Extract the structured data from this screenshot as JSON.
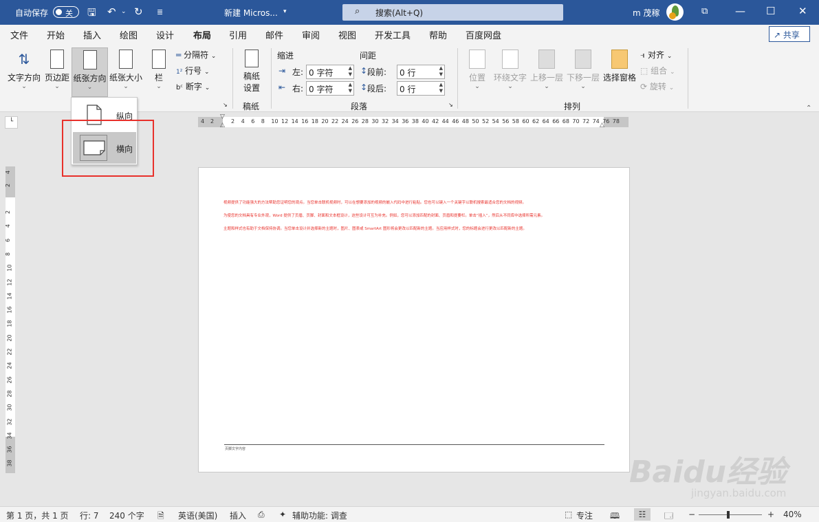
{
  "titlebar": {
    "autosave_label": "自动保存",
    "autosave_state": "关",
    "doc_title": "新建 Micros...",
    "search_placeholder": "搜索(Alt+Q)",
    "user_name": "m 茂稼"
  },
  "menu": {
    "tabs": [
      "文件",
      "开始",
      "插入",
      "绘图",
      "设计",
      "布局",
      "引用",
      "邮件",
      "审阅",
      "视图",
      "开发工具",
      "帮助",
      "百度网盘"
    ],
    "active": "布局",
    "share": "共享"
  },
  "ribbon": {
    "text_direction": "文字方向",
    "margins": "页边距",
    "orientation": "纸张方向",
    "size": "纸张大小",
    "columns": "栏",
    "breaks": "分隔符",
    "line_numbers": "行号",
    "hyphenation": "断字",
    "draft_settings_line1": "稿纸",
    "draft_settings_line2": "设置",
    "draft_group": "稿纸",
    "indent_label": "缩进",
    "spacing_label": "间距",
    "indent_left_label": "左:",
    "indent_left_value": "0 字符",
    "indent_right_label": "右:",
    "indent_right_value": "0 字符",
    "space_before_label": "段前:",
    "space_before_value": "0 行",
    "space_after_label": "段后:",
    "space_after_value": "0 行",
    "paragraph_group": "段落",
    "position": "位置",
    "wrap_text": "环绕文字",
    "bring_forward": "上移一层",
    "send_backward": "下移一层",
    "selection_pane": "选择窗格",
    "align": "对齐",
    "group": "组合",
    "rotate": "旋转",
    "arrange_group": "排列"
  },
  "orientation_menu": {
    "portrait": "纵向",
    "landscape": "横向",
    "selected": "横向"
  },
  "ruler": {
    "h_ticks": [
      "4",
      "2",
      "2",
      "4",
      "6",
      "8",
      "10",
      "12",
      "14",
      "16",
      "18",
      "20",
      "22",
      "24",
      "26",
      "28",
      "30",
      "32",
      "34",
      "36",
      "38",
      "40",
      "42",
      "44",
      "46",
      "48",
      "50",
      "52",
      "54",
      "56",
      "58",
      "60",
      "62",
      "64",
      "66",
      "68",
      "70",
      "72",
      "74",
      "76",
      "78"
    ],
    "v_ticks": [
      "4",
      "2",
      "2",
      "4",
      "6",
      "8",
      "10",
      "12",
      "14",
      "16",
      "18",
      "20",
      "22",
      "24",
      "26",
      "28",
      "30",
      "32",
      "34",
      "36",
      "38"
    ]
  },
  "document": {
    "paragraphs": [
      "视频提供了功能强大的方法帮助您证明您的观点。当您单击联机视频时，可以在想要添加的视频的嵌入代码中进行粘贴。您也可以键入一个关键字以联机搜索最适合您的文档的视频。",
      "为使您的文档具有专业外观，Word 提供了页眉、页脚、封面和文本框设计，这些设计可互为补充。例如，您可以添加匹配的封面、页眉和提要栏。单击“插入”，然后从不同库中选择所需元素。",
      "主题和样式也有助于文档保持协调。当您单击设计并选择新的主题时，图片、图表或 SmartArt 图形将会更改以匹配新的主题。当应用样式时，您的标题会进行更改以匹配新的主题。"
    ],
    "footer": "页脚文字内容"
  },
  "status": {
    "page": "第 1 页，共 1 页",
    "line": "行: 7",
    "words": "240 个字",
    "language": "英语(美国)",
    "mode": "插入",
    "accessibility": "辅助功能: 调查",
    "focus": "专注",
    "zoom": "40%"
  },
  "watermark": {
    "brand": "Baidu经验",
    "url": "jingyan.baidu.com"
  },
  "colors": {
    "titlebar": "#2b579a",
    "highlight_box": "#e8302a",
    "doc_text": "#e8302a"
  }
}
